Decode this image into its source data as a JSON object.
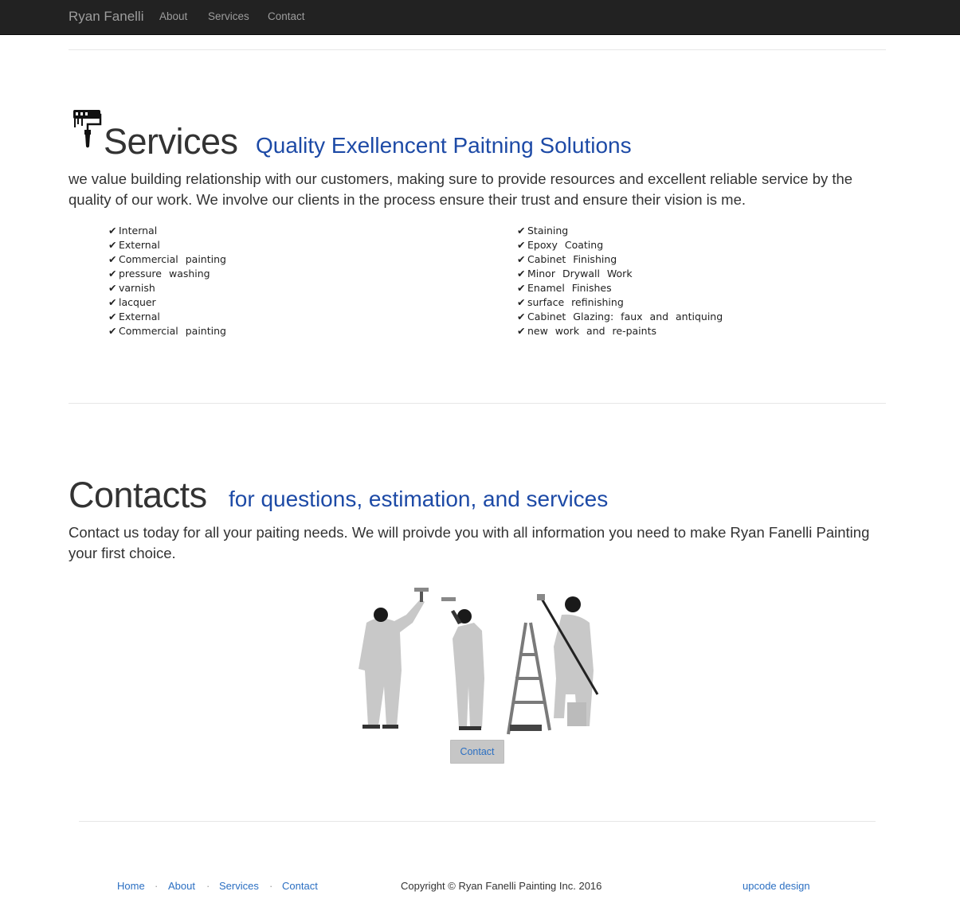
{
  "navbar": {
    "brand": "Ryan Fanelli",
    "links": [
      "About",
      "Services",
      "Contact"
    ]
  },
  "services": {
    "icon": "paint-roller-icon",
    "title": "Services",
    "subtitle": "Quality Exellencent Paitning Solutions",
    "intro": "we value building relationship with our customers, making sure to provide resources and excellent reliable service by the quality of our work. We involve our clients in the process ensure their trust and ensure their vision is me.",
    "check_glyph": "✔",
    "left_list": [
      "Internal",
      "External",
      "Commercial painting",
      "pressure washing",
      "varnish",
      "lacquer",
      "External",
      "Commercial painting"
    ],
    "right_list": [
      "Staining",
      "Epoxy Coating",
      "Cabinet Finishing",
      "Minor Drywall Work",
      "Enamel Finishes",
      "surface refinishing",
      "Cabinet Glazing: faux and antiquing",
      "new work and re-paints"
    ]
  },
  "contacts": {
    "title": "Contacts",
    "subtitle": "for questions, estimation, and services",
    "intro": "Contact us today for all your paiting needs. We will proivde you with all information you need to make Ryan Fanelli Painting your first choice.",
    "image": "painters-illustration",
    "button_label": "Contact"
  },
  "footer": {
    "links": [
      "Home",
      "About",
      "Services",
      "Contact"
    ],
    "separator": "·",
    "copyright": "Copyright © Ryan Fanelli Painting Inc. 2016",
    "credit": "upcode design"
  },
  "colors": {
    "navbar_bg": "#222222",
    "accent_blue": "#1d4aa6",
    "link_blue": "#2b6fc2",
    "button_bg": "#c6c6c6"
  }
}
